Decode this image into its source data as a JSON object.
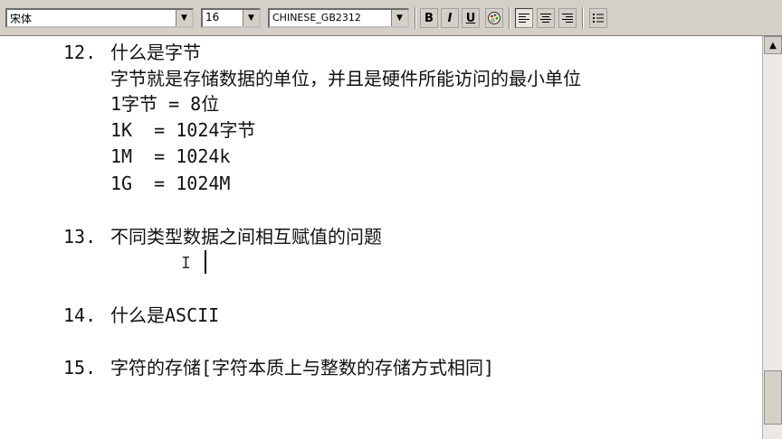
{
  "toolbar": {
    "font_name": "宋体",
    "font_size": "16",
    "charset": "CHINESE_GB2312",
    "dropdown_arrow": "▼",
    "bold_label": "B",
    "italic_label": "I",
    "underline_label": "U",
    "color_icon": "palette-icon",
    "align_left_icon": "align-left-icon",
    "align_center_icon": "align-center-icon",
    "align_right_icon": "align-right-icon",
    "bullets_icon": "bullets-icon"
  },
  "document": {
    "items": [
      {
        "num": "12.",
        "lines": [
          "什么是字节",
          "字节就是存储数据的单位，并且是硬件所能访问的最小单位",
          "1字节 = 8位",
          "1K  = 1024字节",
          "1M  = 1024k",
          "1G  = 1024M"
        ]
      },
      {
        "num": "13.",
        "lines": [
          "不同类型数据之间相互赋值的问题"
        ]
      },
      {
        "num": "14.",
        "lines": [
          "什么是ASCII"
        ]
      },
      {
        "num": "15.",
        "lines": [
          "字符的存储[字符本质上与整数的存储方式相同]"
        ]
      }
    ],
    "ibeam_glyph": "I"
  }
}
